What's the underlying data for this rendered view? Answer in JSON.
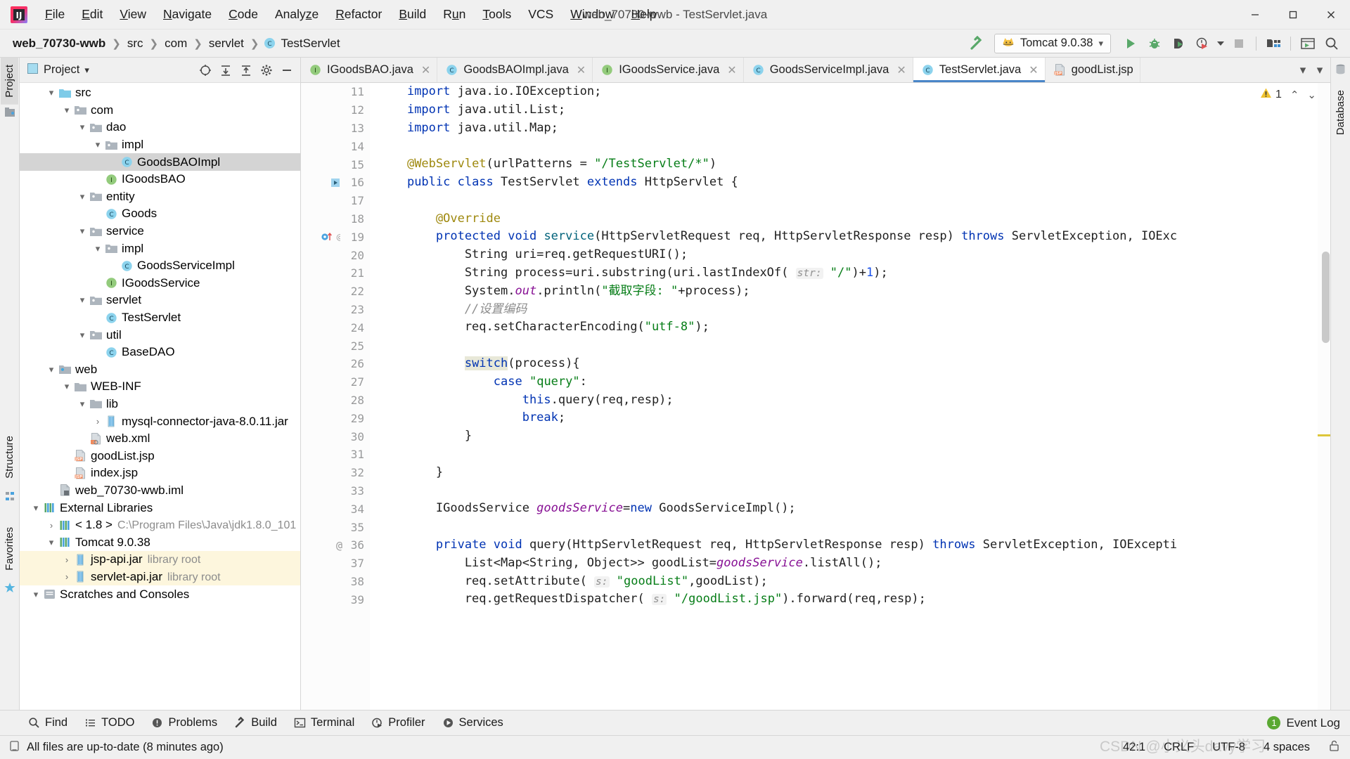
{
  "window": {
    "title": "web_70730-wwb - TestServlet.java",
    "minimize": "−",
    "maximize": "▢",
    "close": "✕"
  },
  "menu": [
    {
      "label": "File",
      "mnemonic": "F"
    },
    {
      "label": "Edit",
      "mnemonic": "E"
    },
    {
      "label": "View",
      "mnemonic": "V"
    },
    {
      "label": "Navigate",
      "mnemonic": "N"
    },
    {
      "label": "Code",
      "mnemonic": "C"
    },
    {
      "label": "Analyze",
      "mnemonic": "z"
    },
    {
      "label": "Refactor",
      "mnemonic": "R"
    },
    {
      "label": "Build",
      "mnemonic": "B"
    },
    {
      "label": "Run",
      "mnemonic": "u"
    },
    {
      "label": "Tools",
      "mnemonic": "T"
    },
    {
      "label": "VCS",
      "mnemonic": ""
    },
    {
      "label": "Window",
      "mnemonic": "W"
    },
    {
      "label": "Help",
      "mnemonic": "H"
    }
  ],
  "navbar": {
    "crumbs": [
      "web_70730-wwb",
      "src",
      "com",
      "servlet",
      "TestServlet"
    ],
    "separator": "❯",
    "class_badge": "C"
  },
  "toolbar": {
    "hammer_icon": "build-hammer-icon",
    "run_config": "Tomcat 9.0.38",
    "run_config_icon": "tomcat-cat-icon",
    "dropdown_caret": "▾",
    "buttons": [
      {
        "name": "run-button",
        "icon": "play-icon"
      },
      {
        "name": "debug-button",
        "icon": "bug-icon"
      },
      {
        "name": "run-with-coverage-button",
        "icon": "coverage-icon"
      },
      {
        "name": "profile-button",
        "icon": "profiler-clock-icon"
      },
      {
        "name": "profile-dropdown",
        "icon": "caret-down-icon"
      },
      {
        "name": "stop-button",
        "icon": "stop-square-icon"
      },
      {
        "name": "project-structure-button",
        "icon": "project-structure-icon"
      },
      {
        "name": "updates-button",
        "icon": "window-icon"
      },
      {
        "name": "search-everywhere-button",
        "icon": "search-icon"
      }
    ]
  },
  "left_strip": {
    "tabs": [
      {
        "label": "Project",
        "selected": true
      },
      {
        "label": "Structure",
        "selected": false
      },
      {
        "label": "Favorites",
        "selected": false
      }
    ]
  },
  "right_strip": {
    "tabs": [
      {
        "label": "Database",
        "selected": false
      }
    ]
  },
  "project_panel": {
    "title": "Project",
    "title_caret": "▾",
    "actions": [
      "locate-icon",
      "expand-all-icon",
      "collapse-all-icon",
      "settings-gear-icon",
      "hide-icon"
    ],
    "tree": [
      {
        "depth": 1,
        "twisty": "▾",
        "icon": "folder-src",
        "label": "src",
        "sub": "",
        "state": "normal"
      },
      {
        "depth": 2,
        "twisty": "▾",
        "icon": "folder-package",
        "label": "com",
        "sub": "",
        "state": "normal"
      },
      {
        "depth": 3,
        "twisty": "▾",
        "icon": "folder-package",
        "label": "dao",
        "sub": "",
        "state": "normal"
      },
      {
        "depth": 4,
        "twisty": "▾",
        "icon": "folder-package",
        "label": "impl",
        "sub": "",
        "state": "normal"
      },
      {
        "depth": 5,
        "twisty": "",
        "icon": "class",
        "label": "GoodsBAOImpl",
        "sub": "",
        "state": "selected"
      },
      {
        "depth": 4,
        "twisty": "",
        "icon": "interface",
        "label": "IGoodsBAO",
        "sub": "",
        "state": "normal"
      },
      {
        "depth": 3,
        "twisty": "▾",
        "icon": "folder-package",
        "label": "entity",
        "sub": "",
        "state": "normal"
      },
      {
        "depth": 4,
        "twisty": "",
        "icon": "class",
        "label": "Goods",
        "sub": "",
        "state": "normal"
      },
      {
        "depth": 3,
        "twisty": "▾",
        "icon": "folder-package",
        "label": "service",
        "sub": "",
        "state": "normal"
      },
      {
        "depth": 4,
        "twisty": "▾",
        "icon": "folder-package",
        "label": "impl",
        "sub": "",
        "state": "normal"
      },
      {
        "depth": 5,
        "twisty": "",
        "icon": "class",
        "label": "GoodsServiceImpl",
        "sub": "",
        "state": "normal"
      },
      {
        "depth": 4,
        "twisty": "",
        "icon": "interface",
        "label": "IGoodsService",
        "sub": "",
        "state": "normal"
      },
      {
        "depth": 3,
        "twisty": "▾",
        "icon": "folder-package",
        "label": "servlet",
        "sub": "",
        "state": "normal"
      },
      {
        "depth": 4,
        "twisty": "",
        "icon": "class",
        "label": "TestServlet",
        "sub": "",
        "state": "normal"
      },
      {
        "depth": 3,
        "twisty": "▾",
        "icon": "folder-package",
        "label": "util",
        "sub": "",
        "state": "normal"
      },
      {
        "depth": 4,
        "twisty": "",
        "icon": "class",
        "label": "BaseDAO",
        "sub": "",
        "state": "normal"
      },
      {
        "depth": 1,
        "twisty": "▾",
        "icon": "folder-web",
        "label": "web",
        "sub": "",
        "state": "normal"
      },
      {
        "depth": 2,
        "twisty": "▾",
        "icon": "folder-plain",
        "label": "WEB-INF",
        "sub": "",
        "state": "normal"
      },
      {
        "depth": 3,
        "twisty": "▾",
        "icon": "folder-plain",
        "label": "lib",
        "sub": "",
        "state": "normal"
      },
      {
        "depth": 4,
        "twisty": "›",
        "icon": "jar",
        "label": "mysql-connector-java-8.0.11.jar",
        "sub": "",
        "state": "normal"
      },
      {
        "depth": 3,
        "twisty": "",
        "icon": "xml",
        "label": "web.xml",
        "sub": "",
        "state": "normal"
      },
      {
        "depth": 2,
        "twisty": "",
        "icon": "jsp",
        "label": "goodList.jsp",
        "sub": "",
        "state": "normal"
      },
      {
        "depth": 2,
        "twisty": "",
        "icon": "jsp",
        "label": "index.jsp",
        "sub": "",
        "state": "normal"
      },
      {
        "depth": 1,
        "twisty": "",
        "icon": "iml",
        "label": "web_70730-wwb.iml",
        "sub": "",
        "state": "normal"
      },
      {
        "depth": 0,
        "twisty": "▾",
        "icon": "libraries",
        "label": "External Libraries",
        "sub": "",
        "state": "normal"
      },
      {
        "depth": 1,
        "twisty": "›",
        "icon": "jdk",
        "label": "< 1.8 >",
        "sub": "C:\\Program Files\\Java\\jdk1.8.0_101",
        "state": "normal"
      },
      {
        "depth": 1,
        "twisty": "▾",
        "icon": "libraries",
        "label": "Tomcat 9.0.38",
        "sub": "",
        "state": "normal"
      },
      {
        "depth": 2,
        "twisty": "›",
        "icon": "jar",
        "label": "jsp-api.jar",
        "sub": "library root",
        "state": "highlight"
      },
      {
        "depth": 2,
        "twisty": "›",
        "icon": "jar",
        "label": "servlet-api.jar",
        "sub": "library root",
        "state": "highlight"
      },
      {
        "depth": 0,
        "twisty": "▾",
        "icon": "scratches",
        "label": "Scratches and Consoles",
        "sub": "",
        "state": "normal"
      }
    ]
  },
  "editor": {
    "tabs": [
      {
        "label": "IGoodsBAO.java",
        "icon": "interface",
        "active": false,
        "close": "✕"
      },
      {
        "label": "GoodsBAOImpl.java",
        "icon": "class",
        "active": false,
        "close": "✕"
      },
      {
        "label": "IGoodsService.java",
        "icon": "interface",
        "active": false,
        "close": "✕"
      },
      {
        "label": "GoodsServiceImpl.java",
        "icon": "class",
        "active": false,
        "close": "✕"
      },
      {
        "label": "TestServlet.java",
        "icon": "class",
        "active": true,
        "close": "✕"
      },
      {
        "label": "goodList.jsp",
        "icon": "jsp",
        "active": false,
        "close": ""
      }
    ],
    "tabs_overflow_caret": "▾",
    "inspection": {
      "warning_count": "1",
      "warning_icon": "warning-triangle-icon",
      "up": "⌃",
      "down": "⌄"
    },
    "first_line_number": 11,
    "lines": [
      {
        "n": 11,
        "gutter": "",
        "fold": "",
        "tokens": [
          {
            "t": "    ",
            "c": ""
          },
          {
            "t": "import",
            "c": "kw"
          },
          {
            "t": " java.io.IOException;",
            "c": ""
          }
        ]
      },
      {
        "n": 12,
        "gutter": "",
        "fold": "",
        "tokens": [
          {
            "t": "    ",
            "c": ""
          },
          {
            "t": "import",
            "c": "kw"
          },
          {
            "t": " java.util.List;",
            "c": ""
          }
        ]
      },
      {
        "n": 13,
        "gutter": "",
        "fold": "fold",
        "tokens": [
          {
            "t": "    ",
            "c": ""
          },
          {
            "t": "import",
            "c": "kw"
          },
          {
            "t": " java.util.Map;",
            "c": ""
          }
        ]
      },
      {
        "n": 14,
        "gutter": "",
        "fold": "",
        "tokens": []
      },
      {
        "n": 15,
        "gutter": "",
        "fold": "",
        "tokens": [
          {
            "t": "    ",
            "c": ""
          },
          {
            "t": "@WebServlet",
            "c": "ann"
          },
          {
            "t": "(urlPatterns = ",
            "c": ""
          },
          {
            "t": "\"/TestServlet/*\"",
            "c": "str"
          },
          {
            "t": ")",
            "c": ""
          }
        ]
      },
      {
        "n": 16,
        "gutter": "run-class",
        "fold": "",
        "tokens": [
          {
            "t": "    ",
            "c": ""
          },
          {
            "t": "public class",
            "c": "kw"
          },
          {
            "t": " TestServlet ",
            "c": ""
          },
          {
            "t": "extends",
            "c": "kw"
          },
          {
            "t": " HttpServlet {",
            "c": ""
          }
        ]
      },
      {
        "n": 17,
        "gutter": "",
        "fold": "",
        "tokens": []
      },
      {
        "n": 18,
        "gutter": "",
        "fold": "",
        "tokens": [
          {
            "t": "        ",
            "c": ""
          },
          {
            "t": "@Override",
            "c": "ann"
          }
        ]
      },
      {
        "n": 19,
        "gutter": "override-at",
        "fold": "fold",
        "tokens": [
          {
            "t": "        ",
            "c": ""
          },
          {
            "t": "protected void",
            "c": "kw"
          },
          {
            "t": " ",
            "c": ""
          },
          {
            "t": "service",
            "c": "fn"
          },
          {
            "t": "(HttpServletRequest req, HttpServletResponse resp) ",
            "c": ""
          },
          {
            "t": "throws",
            "c": "kw"
          },
          {
            "t": " ServletException, IOExc",
            "c": ""
          }
        ]
      },
      {
        "n": 20,
        "gutter": "",
        "fold": "",
        "tokens": [
          {
            "t": "            String uri=req.getRequestURI();",
            "c": ""
          }
        ]
      },
      {
        "n": 21,
        "gutter": "",
        "fold": "",
        "tokens": [
          {
            "t": "            String process=uri.substring(uri.lastIndexOf( ",
            "c": ""
          },
          {
            "t": "str:",
            "c": "hint"
          },
          {
            "t": " ",
            "c": ""
          },
          {
            "t": "\"/\"",
            "c": "str"
          },
          {
            "t": ")+",
            "c": ""
          },
          {
            "t": "1",
            "c": "num"
          },
          {
            "t": ");",
            "c": ""
          }
        ]
      },
      {
        "n": 22,
        "gutter": "",
        "fold": "",
        "tokens": [
          {
            "t": "            System.",
            "c": ""
          },
          {
            "t": "out",
            "c": "field"
          },
          {
            "t": ".println(",
            "c": ""
          },
          {
            "t": "\"截取字段: \"",
            "c": "str"
          },
          {
            "t": "+process);",
            "c": ""
          }
        ]
      },
      {
        "n": 23,
        "gutter": "",
        "fold": "",
        "tokens": [
          {
            "t": "            //设置编码",
            "c": "cmt"
          }
        ]
      },
      {
        "n": 24,
        "gutter": "",
        "fold": "",
        "tokens": [
          {
            "t": "            req.setCharacterEncoding(",
            "c": ""
          },
          {
            "t": "\"utf-8\"",
            "c": "str"
          },
          {
            "t": ");",
            "c": ""
          }
        ]
      },
      {
        "n": 25,
        "gutter": "",
        "fold": "",
        "tokens": []
      },
      {
        "n": 26,
        "gutter": "",
        "fold": "fold",
        "tokens": [
          {
            "t": "            ",
            "c": ""
          },
          {
            "t": "switch",
            "c": "kw sel-tok"
          },
          {
            "t": "(process){",
            "c": ""
          }
        ]
      },
      {
        "n": 27,
        "gutter": "",
        "fold": "",
        "tokens": [
          {
            "t": "                ",
            "c": ""
          },
          {
            "t": "case",
            "c": "kw"
          },
          {
            "t": " ",
            "c": ""
          },
          {
            "t": "\"query\"",
            "c": "str"
          },
          {
            "t": ":",
            "c": ""
          }
        ]
      },
      {
        "n": 28,
        "gutter": "",
        "fold": "",
        "tokens": [
          {
            "t": "                    ",
            "c": ""
          },
          {
            "t": "this",
            "c": "kw"
          },
          {
            "t": ".query(req,resp);",
            "c": ""
          }
        ]
      },
      {
        "n": 29,
        "gutter": "",
        "fold": "",
        "tokens": [
          {
            "t": "                    ",
            "c": ""
          },
          {
            "t": "break",
            "c": "kw"
          },
          {
            "t": ";",
            "c": ""
          }
        ]
      },
      {
        "n": 30,
        "gutter": "",
        "fold": "fold-end",
        "tokens": [
          {
            "t": "            }",
            "c": ""
          }
        ]
      },
      {
        "n": 31,
        "gutter": "",
        "fold": "",
        "tokens": []
      },
      {
        "n": 32,
        "gutter": "",
        "fold": "fold-end",
        "tokens": [
          {
            "t": "        }",
            "c": ""
          }
        ]
      },
      {
        "n": 33,
        "gutter": "",
        "fold": "",
        "tokens": []
      },
      {
        "n": 34,
        "gutter": "",
        "fold": "",
        "tokens": [
          {
            "t": "        IGoodsService ",
            "c": ""
          },
          {
            "t": "goodsService",
            "c": "field"
          },
          {
            "t": "=",
            "c": ""
          },
          {
            "t": "new",
            "c": "kw"
          },
          {
            "t": " GoodsServiceImpl();",
            "c": ""
          }
        ]
      },
      {
        "n": 35,
        "gutter": "",
        "fold": "",
        "tokens": []
      },
      {
        "n": 36,
        "gutter": "at-only",
        "fold": "",
        "tokens": [
          {
            "t": "        ",
            "c": ""
          },
          {
            "t": "private void",
            "c": "kw"
          },
          {
            "t": " query(HttpServletRequest req, HttpServletResponse resp) ",
            "c": ""
          },
          {
            "t": "throws",
            "c": "kw"
          },
          {
            "t": " ServletException, IOExcepti",
            "c": ""
          }
        ]
      },
      {
        "n": 37,
        "gutter": "",
        "fold": "",
        "tokens": [
          {
            "t": "            List<Map<String, Object>> goodList=",
            "c": ""
          },
          {
            "t": "goodsService",
            "c": "field"
          },
          {
            "t": ".listAll();",
            "c": ""
          }
        ]
      },
      {
        "n": 38,
        "gutter": "",
        "fold": "",
        "tokens": [
          {
            "t": "            req.setAttribute( ",
            "c": ""
          },
          {
            "t": "s:",
            "c": "hint"
          },
          {
            "t": " ",
            "c": ""
          },
          {
            "t": "\"goodList\"",
            "c": "str"
          },
          {
            "t": ",goodList);",
            "c": ""
          }
        ]
      },
      {
        "n": 39,
        "gutter": "",
        "fold": "",
        "tokens": [
          {
            "t": "            req.getRequestDispatcher( ",
            "c": ""
          },
          {
            "t": "s:",
            "c": "hint"
          },
          {
            "t": " ",
            "c": ""
          },
          {
            "t": "\"/goodList.jsp\"",
            "c": "str"
          },
          {
            "t": ").forward(req,resp);",
            "c": ""
          }
        ]
      }
    ]
  },
  "tool_window_bar": {
    "items": [
      {
        "label": "Find",
        "icon": "search-icon"
      },
      {
        "label": "TODO",
        "icon": "todo-list-icon"
      },
      {
        "label": "Problems",
        "icon": "problems-icon"
      },
      {
        "label": "Build",
        "icon": "hammer-icon"
      },
      {
        "label": "Terminal",
        "icon": "terminal-icon"
      },
      {
        "label": "Profiler",
        "icon": "profiler-icon"
      },
      {
        "label": "Services",
        "icon": "services-icon"
      }
    ],
    "event_log": {
      "label": "Event Log",
      "badge": "1"
    }
  },
  "statusbar": {
    "message": "All files are up-to-date (8 minutes ago)",
    "message_icon": "document-icon",
    "caret_position": "42:1",
    "line_separator": "CRLF",
    "encoding": "UTF-8",
    "indent": "4 spaces",
    "lock_icon": "unlocked-icon"
  },
  "watermark": "CSDN @小义头davy学习"
}
